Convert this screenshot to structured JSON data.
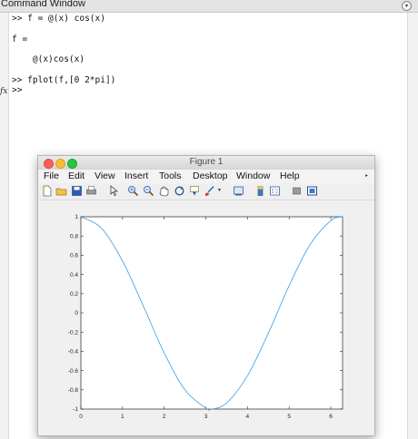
{
  "command_window": {
    "title": "Command Window",
    "lines": [
      ">> f = @(x) cos(x)",
      "f =",
      "    @(x)cos(x)",
      ">> fplot(f,[0 2*pi])",
      ">>"
    ],
    "fx_label": "fx"
  },
  "figure": {
    "title": "Figure 1",
    "menu": [
      "File",
      "Edit",
      "View",
      "Insert",
      "Tools",
      "Desktop",
      "Window",
      "Help"
    ],
    "toolbar_icons": [
      "new-file-icon",
      "open-folder-icon",
      "save-icon",
      "print-icon",
      "pointer-icon",
      "zoom-in-icon",
      "zoom-out-icon",
      "pan-hand-icon",
      "rotate-3d-icon",
      "data-cursor-icon",
      "brush-icon",
      "link-plot-icon",
      "colorbar-icon",
      "legend-icon",
      "hide-tools-icon",
      "dock-icon"
    ],
    "traffic_colors": [
      "#fc5f57",
      "#fdbc2e",
      "#28c840"
    ]
  },
  "chart_data": {
    "type": "line",
    "title": "",
    "xlabel": "",
    "ylabel": "",
    "xlim": [
      0,
      6.2832
    ],
    "ylim": [
      -1,
      1
    ],
    "xticks": [
      "0",
      "1",
      "2",
      "3",
      "4",
      "5",
      "6"
    ],
    "yticks": [
      "-1",
      "-0.8",
      "-0.6",
      "-0.4",
      "-0.2",
      "0",
      "0.2",
      "0.4",
      "0.6",
      "0.8",
      "1"
    ],
    "series": [
      {
        "color": "#4da6e8",
        "x": [
          0,
          0.5,
          1,
          1.5,
          2,
          2.5,
          3,
          3.1416,
          3.5,
          4,
          4.5,
          5,
          5.5,
          6,
          6.2832
        ],
        "y": [
          1,
          0.878,
          0.54,
          0.071,
          -0.416,
          -0.801,
          -0.99,
          -1,
          -0.936,
          -0.654,
          -0.211,
          0.284,
          0.709,
          0.96,
          1
        ]
      }
    ],
    "grid": false
  }
}
